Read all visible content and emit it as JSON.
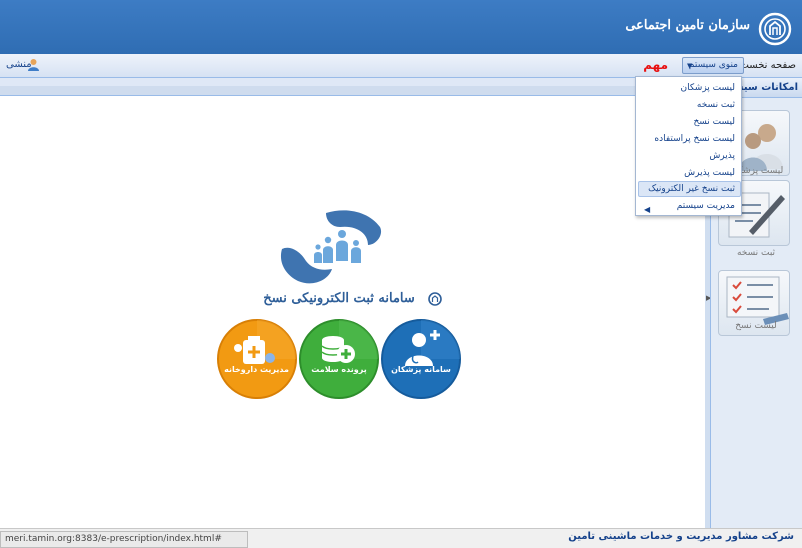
{
  "header": {
    "org_name": "سازمان تامین اجتماعی",
    "logo_icon": "tamin-logo-icon",
    "bg_color": "#2f6db3"
  },
  "toolbar": {
    "home": "صفحه نخست",
    "system_menu": "منوی سیستم",
    "important": "مهم",
    "user": "منشی",
    "important_color": "#e81010"
  },
  "dropdown": {
    "items": [
      "لیست پزشکان",
      "ثبت نسخه",
      "لیست نسخ",
      "لیست نسخ پراستفاده",
      "پذیرش",
      "لیست پذیرش",
      "ثبت نسخ غیر الکترونیک",
      "مدیریت سیستم"
    ],
    "highlighted": "ثبت نسخ غیر الکترونیک"
  },
  "side_panel": {
    "title": "امکانات سیستم",
    "tiles": [
      "لیست پزشکان",
      "ثبت نسخه",
      "لیست نسخ"
    ]
  },
  "banner": {
    "title": "سامانه ثبت الکترونیکی نسخ",
    "circles": [
      "مدیریت داروخانه",
      "پرونده سلامت",
      "سامانه پزشکان"
    ],
    "circle_colors": [
      "#f29a12",
      "#3fae3c",
      "#1e6fb7"
    ]
  },
  "statusbar": {
    "url": "meri.tamin.org:8383/e-prescription/index.html#",
    "footer": "شرکت مشاور مدیریت و خدمات ماشینی تامین"
  }
}
